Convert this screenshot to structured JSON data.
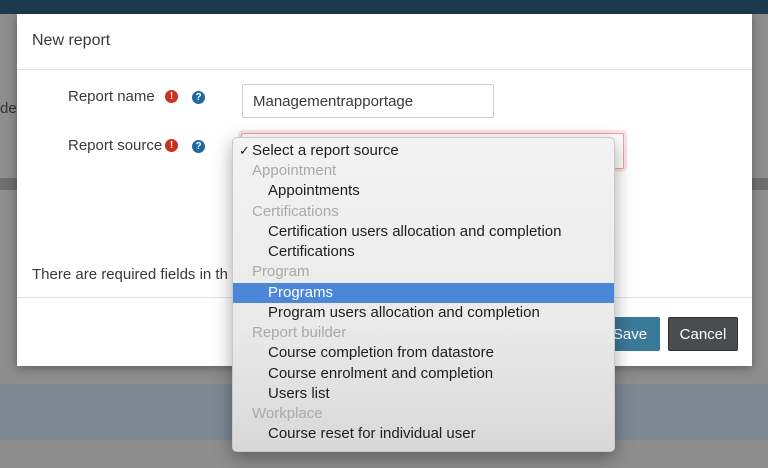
{
  "background": {
    "peek_text": "der"
  },
  "modal": {
    "title": "New report",
    "report_name": {
      "label": "Report name",
      "value": "Managementrapportage"
    },
    "report_source": {
      "label": "Report source"
    },
    "required_note": "There are required fields in th",
    "save_label": "Save",
    "cancel_label": "Cancel"
  },
  "dropdown": {
    "placeholder": "Select a report source",
    "check": "✓",
    "options": [
      {
        "text": "Appointment"
      },
      {
        "text": "Appointments"
      },
      {
        "text": "Certifications"
      },
      {
        "text": "Certification users allocation and completion"
      },
      {
        "text": "Certifications"
      },
      {
        "text": "Program"
      },
      {
        "text": "Programs"
      },
      {
        "text": "Program users allocation and completion"
      },
      {
        "text": "Report builder"
      },
      {
        "text": "Course completion from datastore"
      },
      {
        "text": "Course enrolment and completion"
      },
      {
        "text": "Users list"
      },
      {
        "text": "Workplace"
      },
      {
        "text": "Course reset for individual user"
      }
    ]
  },
  "colors": {
    "required": "#ca3120",
    "help": "#1d6aa5",
    "highlight": "#4b86d8",
    "save": "#3b7998",
    "cancel": "#4a4c4e"
  }
}
